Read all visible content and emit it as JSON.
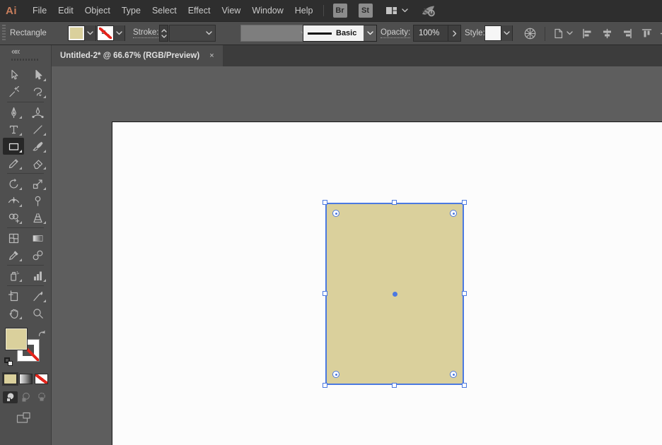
{
  "menubar": {
    "logo": "Ai",
    "items": [
      "File",
      "Edit",
      "Object",
      "Type",
      "Select",
      "Effect",
      "View",
      "Window",
      "Help"
    ],
    "bridge_label": "Br",
    "stock_label": "St",
    "icons": [
      "workspace-switcher-icon",
      "chevron-down-icon",
      "gpu-performance-icon"
    ]
  },
  "control_bar": {
    "selection_label": "Rectangle",
    "stroke_label": "Stroke:",
    "brush_definition_value": "Basic",
    "opacity_label": "Opacity:",
    "opacity_value": "100%",
    "style_label": "Style:",
    "icons": [
      "recolor-artwork-icon",
      "document-setup-icon",
      "align-left-icon",
      "align-center-horizontal-icon",
      "align-right-icon",
      "align-top-icon",
      "align-center-vertical-icon"
    ]
  },
  "document_tab": {
    "title": "Untitled-2* @ 66.67% (RGB/Preview)",
    "close_glyph": "×"
  },
  "toolbar": {
    "collapse_glyph": "««",
    "tools": [
      {
        "name": "selection-tool",
        "icon": "selection-tool-icon",
        "flyout": false,
        "selected": false
      },
      {
        "name": "direct-selection-tool",
        "icon": "direct-selection-tool-icon",
        "flyout": true,
        "selected": false
      },
      {
        "name": "magic-wand-tool",
        "icon": "magic-wand-tool-icon",
        "flyout": false,
        "selected": false
      },
      {
        "name": "lasso-tool",
        "icon": "lasso-tool-icon",
        "flyout": true,
        "selected": false
      },
      {
        "divider": true
      },
      {
        "name": "pen-tool",
        "icon": "pen-tool-icon",
        "flyout": true,
        "selected": false
      },
      {
        "name": "curvature-tool",
        "icon": "curvature-tool-icon",
        "flyout": false,
        "selected": false
      },
      {
        "name": "type-tool",
        "icon": "type-tool-icon",
        "flyout": true,
        "selected": false
      },
      {
        "name": "line-segment-tool",
        "icon": "line-segment-tool-icon",
        "flyout": true,
        "selected": false
      },
      {
        "name": "rectangle-tool",
        "icon": "rectangle-tool-icon",
        "flyout": true,
        "selected": true
      },
      {
        "name": "paintbrush-tool",
        "icon": "paintbrush-tool-icon",
        "flyout": true,
        "selected": false
      },
      {
        "name": "shaper-tool",
        "icon": "shaper-tool-icon",
        "flyout": true,
        "selected": false
      },
      {
        "name": "eraser-tool",
        "icon": "eraser-tool-icon",
        "flyout": true,
        "selected": false
      },
      {
        "divider": true
      },
      {
        "name": "rotate-tool",
        "icon": "rotate-tool-icon",
        "flyout": true,
        "selected": false
      },
      {
        "name": "scale-tool",
        "icon": "scale-tool-icon",
        "flyout": true,
        "selected": false
      },
      {
        "name": "width-tool",
        "icon": "width-tool-icon",
        "flyout": true,
        "selected": false
      },
      {
        "name": "puppet-warp-tool",
        "icon": "puppet-warp-tool-icon",
        "flyout": false,
        "selected": false
      },
      {
        "name": "shape-builder-tool",
        "icon": "shape-builder-tool-icon",
        "flyout": true,
        "selected": false
      },
      {
        "name": "perspective-grid-tool",
        "icon": "perspective-grid-tool-icon",
        "flyout": true,
        "selected": false
      },
      {
        "divider": true
      },
      {
        "name": "mesh-tool",
        "icon": "mesh-tool-icon",
        "flyout": false,
        "selected": false
      },
      {
        "name": "gradient-tool",
        "icon": "gradient-tool-icon",
        "flyout": false,
        "selected": false
      },
      {
        "name": "eyedropper-tool",
        "icon": "eyedropper-tool-icon",
        "flyout": true,
        "selected": false
      },
      {
        "name": "blend-tool",
        "icon": "blend-tool-icon",
        "flyout": false,
        "selected": false
      },
      {
        "divider": true
      },
      {
        "name": "symbol-sprayer-tool",
        "icon": "symbol-sprayer-tool-icon",
        "flyout": true,
        "selected": false
      },
      {
        "name": "column-graph-tool",
        "icon": "column-graph-tool-icon",
        "flyout": true,
        "selected": false
      },
      {
        "divider": true
      },
      {
        "name": "artboard-tool",
        "icon": "artboard-tool-icon",
        "flyout": false,
        "selected": false
      },
      {
        "name": "slice-tool",
        "icon": "slice-tool-icon",
        "flyout": true,
        "selected": false
      },
      {
        "name": "hand-tool",
        "icon": "hand-tool-icon",
        "flyout": true,
        "selected": false
      },
      {
        "name": "zoom-tool",
        "icon": "zoom-tool-icon",
        "flyout": false,
        "selected": false
      }
    ]
  },
  "canvas": {
    "selected_object": {
      "type": "rectangle",
      "fill": "#DAD09C",
      "stroke": "none"
    }
  },
  "colors": {
    "object_fill": "#DAD09C",
    "selection_blue": "#4B79E1",
    "none_red": "#E3241B",
    "logo_orange": "#C97E5C",
    "artboard_white": "#FCFCFC"
  }
}
